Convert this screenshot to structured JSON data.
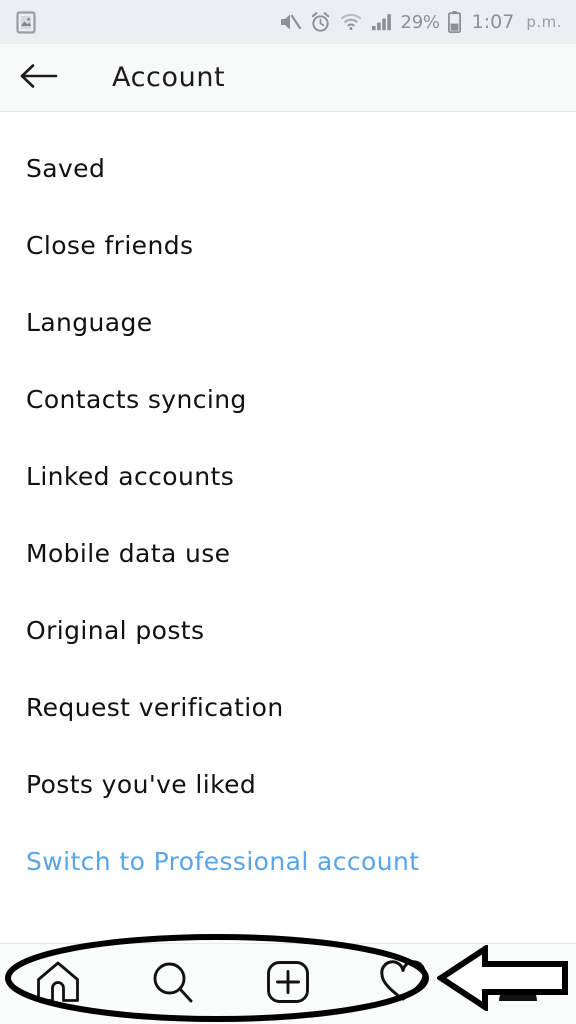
{
  "status_bar": {
    "notification_icon": "image-notification-icon",
    "icons": [
      "volume-muted-icon",
      "alarm-clock-icon",
      "wifi-icon",
      "cellular-signal-icon"
    ],
    "battery_percent": "29%",
    "battery_icon": "battery-icon",
    "time": "1:07",
    "time_suffix": "p.m."
  },
  "header": {
    "back_icon": "back-arrow-icon",
    "title": "Account"
  },
  "settings": {
    "items": [
      {
        "label": "Saved",
        "type": "normal"
      },
      {
        "label": "Close friends",
        "type": "normal"
      },
      {
        "label": "Language",
        "type": "normal"
      },
      {
        "label": "Contacts syncing",
        "type": "normal"
      },
      {
        "label": "Linked accounts",
        "type": "normal"
      },
      {
        "label": "Mobile data use",
        "type": "normal"
      },
      {
        "label": "Original posts",
        "type": "normal"
      },
      {
        "label": "Request verification",
        "type": "normal"
      },
      {
        "label": "Posts you've liked",
        "type": "normal"
      },
      {
        "label": "Switch to Professional account",
        "type": "link"
      }
    ]
  },
  "annotations": {
    "ellipse": "highlight-ellipse-annotation",
    "arrow": "pointer-arrow-annotation",
    "color": "#000000"
  },
  "bottom_nav": {
    "items": [
      {
        "name": "home",
        "icon": "home-icon",
        "active": false
      },
      {
        "name": "search",
        "icon": "search-icon",
        "active": false
      },
      {
        "name": "create",
        "icon": "plus-square-icon",
        "active": false
      },
      {
        "name": "activity",
        "icon": "heart-icon",
        "active": false
      },
      {
        "name": "profile",
        "icon": "person-icon",
        "active": true
      }
    ]
  },
  "colors": {
    "link_blue": "#5aa4e8",
    "text": "#111111",
    "status_text": "#8d9193",
    "status_bg": "#eceff0",
    "header_bg": "#f8f9f9",
    "nav_bg": "#fafbfb"
  }
}
